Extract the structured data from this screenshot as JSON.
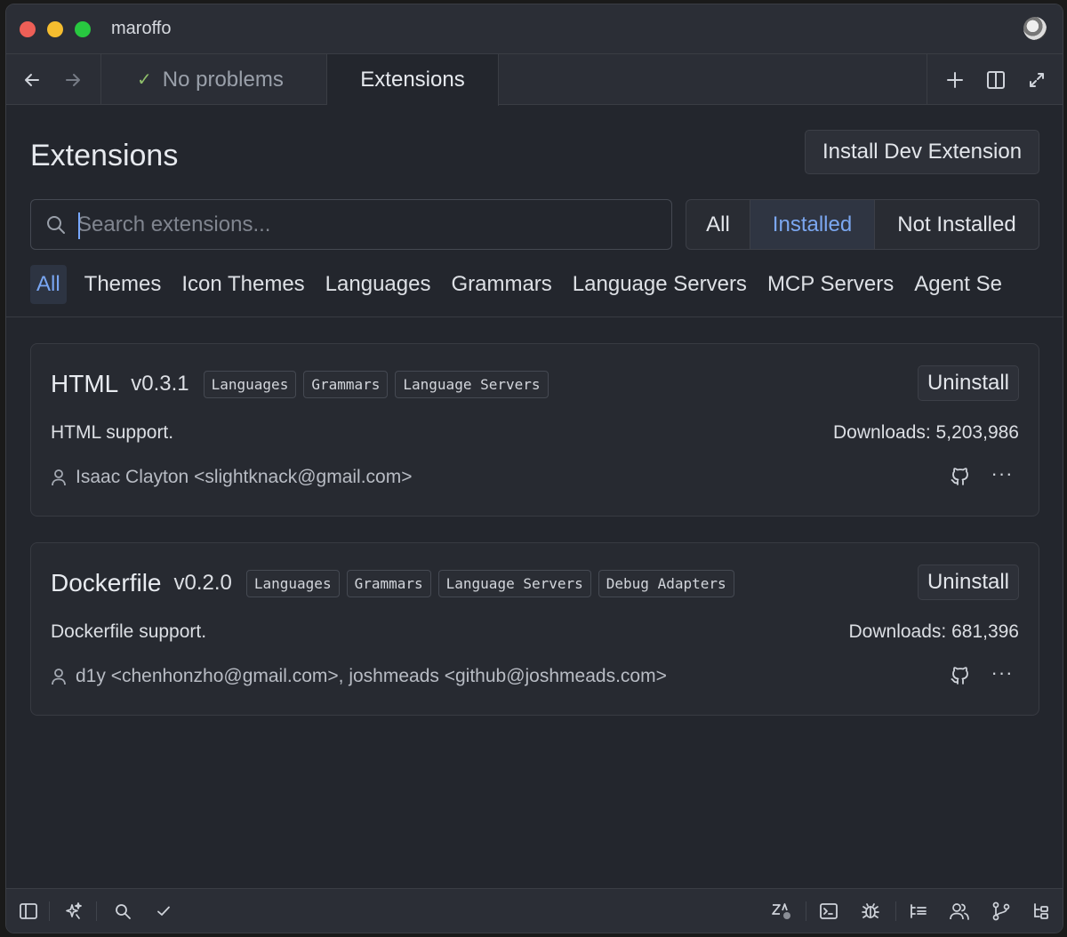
{
  "window": {
    "title": "maroffo"
  },
  "tabs": {
    "problems_label": "No problems",
    "extensions_label": "Extensions"
  },
  "header": {
    "title": "Extensions",
    "install_dev_label": "Install Dev Extension"
  },
  "search": {
    "placeholder": "Search extensions...",
    "value": ""
  },
  "filter": {
    "options": [
      "All",
      "Installed",
      "Not Installed"
    ],
    "selected": "Installed"
  },
  "categories": {
    "items": [
      "All",
      "Themes",
      "Icon Themes",
      "Languages",
      "Grammars",
      "Language Servers",
      "MCP Servers",
      "Agent Se"
    ],
    "selected": "All"
  },
  "extensions": [
    {
      "name": "HTML",
      "version": "v0.3.1",
      "tags": [
        "Languages",
        "Grammars",
        "Language Servers"
      ],
      "action_label": "Uninstall",
      "description": "HTML support.",
      "downloads": "Downloads: 5,203,986",
      "authors": "Isaac Clayton <slightknack@gmail.com>"
    },
    {
      "name": "Dockerfile",
      "version": "v0.2.0",
      "tags": [
        "Languages",
        "Grammars",
        "Language Servers",
        "Debug Adapters"
      ],
      "action_label": "Uninstall",
      "description": "Dockerfile support.",
      "downloads": "Downloads: 681,396",
      "authors": "d1y <chenhonzho@gmail.com>, joshmeads <github@joshmeads.com>"
    }
  ],
  "colors": {
    "accent": "#79a6f2",
    "background": "#23262d",
    "traffic_red": "#ee5f57",
    "traffic_yellow": "#f5bd2f",
    "traffic_green": "#28c840",
    "check_green": "#8fbf6a"
  },
  "icons": {
    "titlebar": [
      "avatar"
    ],
    "tabbar": [
      "arrow-left-icon",
      "arrow-right-icon",
      "check-icon",
      "plus-icon",
      "split-pane-icon",
      "maximize-icon"
    ],
    "statusbar_left": [
      "sidebar-toggle-icon",
      "ai-sparkle-icon",
      "search-icon",
      "check-icon"
    ],
    "statusbar_right": [
      "zed-predict-icon",
      "terminal-icon",
      "debug-bug-icon",
      "outline-icon",
      "collab-users-icon",
      "git-branch-icon",
      "file-tree-icon"
    ]
  }
}
